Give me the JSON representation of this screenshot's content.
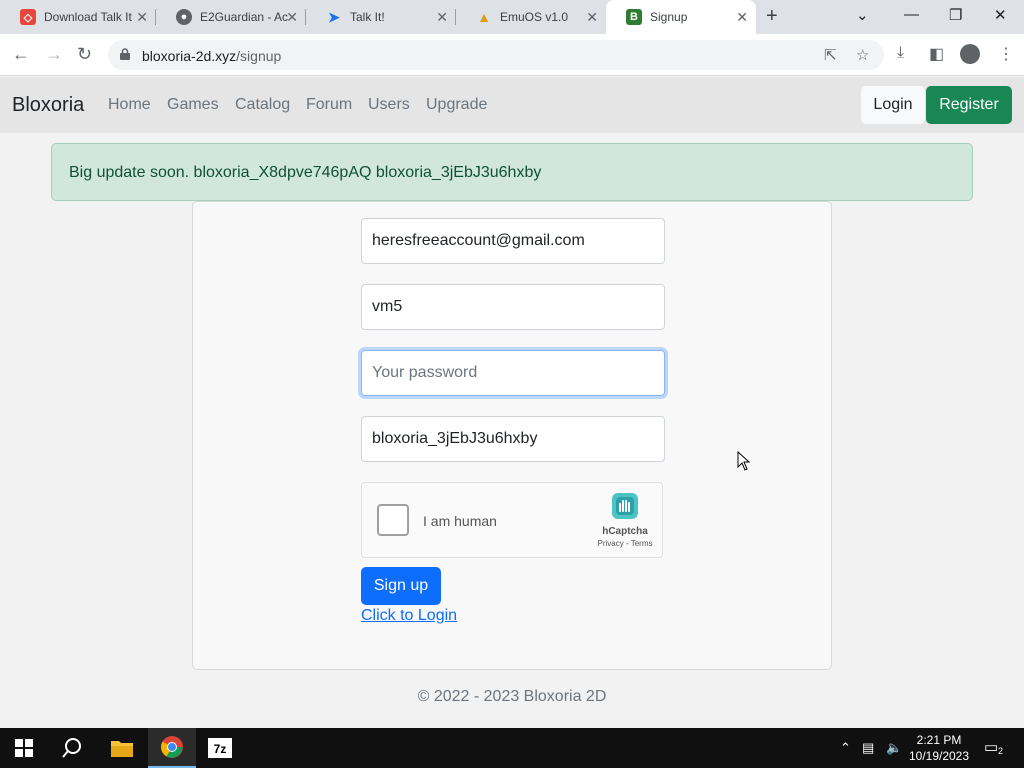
{
  "browser": {
    "tabs": [
      {
        "title": "Download Talk It!",
        "favicon": "talkit-icon",
        "active": false
      },
      {
        "title": "E2Guardian - Ac",
        "favicon": "globe-icon",
        "active": false
      },
      {
        "title": "Talk It!",
        "favicon": "talkit-bubble-icon",
        "active": false
      },
      {
        "title": "EmuOS v1.0",
        "favicon": "emuos-icon",
        "active": false
      },
      {
        "title": "Signup",
        "favicon": "bloxoria-b-icon",
        "favicon_letter": "B",
        "active": true
      }
    ],
    "url_host": "bloxoria-2d.xyz",
    "url_path": "/signup"
  },
  "site": {
    "brand": "Bloxoria",
    "nav": [
      "Home",
      "Games",
      "Catalog",
      "Forum",
      "Users",
      "Upgrade"
    ],
    "login_label": "Login",
    "register_label": "Register",
    "alert_text": "Big update soon. bloxoria_X8dpve746pAQ bloxoria_3jEbJ3u6hxby",
    "form": {
      "email_value": "heresfreeaccount@gmail.com",
      "username_value": "vm5",
      "password_placeholder": "Your password",
      "password_value": "",
      "invite_value": "bloxoria_3jEbJ3u6hxby",
      "captcha_label": "I am human",
      "captcha_brand": "hCaptcha",
      "captcha_links": "Privacy - Terms",
      "signup_label": "Sign up",
      "login_link": "Click to Login"
    },
    "footer": "© 2022 - 2023 Bloxoria 2D"
  },
  "taskbar": {
    "time": "2:21 PM",
    "date": "10/19/2023",
    "notification_count": "2"
  },
  "colors": {
    "register_green": "#198754",
    "signup_blue": "#0d6efd",
    "alert_bg": "#d1e7dd",
    "alert_text": "#0f5132"
  }
}
